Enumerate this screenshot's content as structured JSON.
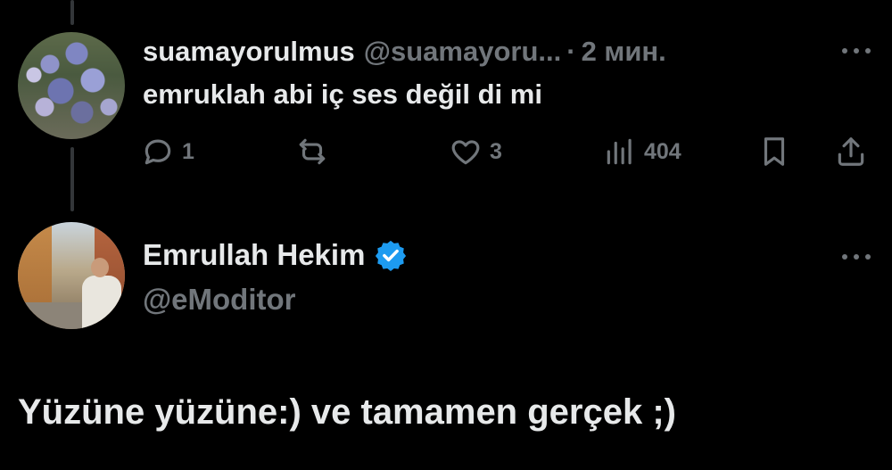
{
  "reply_tweet": {
    "display_name": "suamayorulmus",
    "handle": "@suamayoru...",
    "separator": "·",
    "time": "2 мин.",
    "text": "emruklah abi iç ses değil di mi",
    "avatar": "flowers-photo",
    "actions": {
      "reply": {
        "icon": "reply-icon",
        "count": "1"
      },
      "retweet": {
        "icon": "retweet-icon",
        "count": ""
      },
      "like": {
        "icon": "heart-icon",
        "count": "3"
      },
      "views": {
        "icon": "views-chart-icon",
        "count": "404"
      },
      "bookmark": {
        "icon": "bookmark-icon"
      },
      "share": {
        "icon": "share-icon"
      }
    }
  },
  "main_tweet": {
    "display_name": "Emrullah Hekim",
    "handle": "@eModitor",
    "verified": true,
    "verified_color": "#1d9bf0",
    "avatar": "street-portrait-photo",
    "text": "Yüzüne yüzüne:) ve tamamen gerçek ;)"
  },
  "colors": {
    "background": "#000000",
    "primary_text": "#e7e9ea",
    "secondary_text": "#71767b",
    "thread_line": "#333639"
  }
}
